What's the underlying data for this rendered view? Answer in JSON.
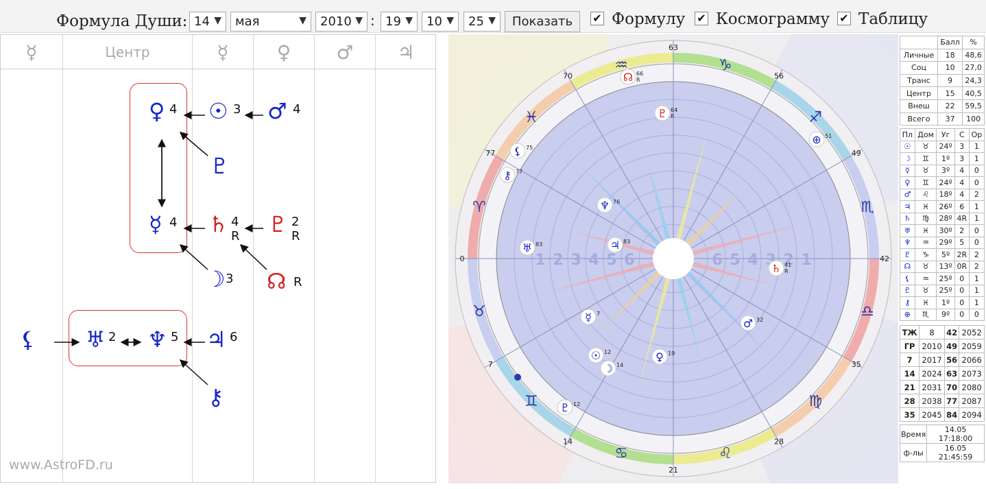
{
  "header": {
    "title": "Формула Души:",
    "day": "14",
    "month": "мая",
    "year": "2010",
    "separator": ":",
    "hour": "19",
    "minute": "10",
    "second": "25",
    "show_button": "Показать",
    "check_formula": "Формулу",
    "check_cosmogram": "Космограмму",
    "check_table": "Таблицу",
    "check_mark": "✔"
  },
  "formula": {
    "columns": [
      "☿",
      "Центр",
      "☿",
      "♀",
      "♂",
      "♃"
    ],
    "watermark": "www.AstroFD.ru",
    "glyphs": {
      "venus": "♀",
      "venus_n": "4",
      "sun": "☉",
      "sun_n": "3",
      "mars": "♂",
      "mars_n": "4",
      "proserpina": "♇",
      "mercury": "☿",
      "mercury_n": "4",
      "saturn": "♄",
      "saturn_n": "4",
      "saturn_r": "R",
      "pluto": "♇",
      "pluto_n": "2",
      "pluto_r": "R",
      "moon": "☽",
      "moon_n": "3",
      "node": "☊",
      "node_r": "R",
      "lilith": "⚸",
      "uranus": "♅",
      "uranus_n": "2",
      "neptune": "♆",
      "neptune_n": "5",
      "jupiter": "♃",
      "jupiter_n": "6",
      "chiron": "⚷"
    }
  },
  "chart": {
    "degrees": [
      "0",
      "7",
      "14",
      "21",
      "28",
      "35",
      "42",
      "49",
      "56",
      "63",
      "70",
      "77"
    ],
    "signs": [
      "♈",
      "♉",
      "♊",
      "♋",
      "♌",
      "♍",
      "♎",
      "♏",
      "♐",
      "♑",
      "♒",
      "♓"
    ],
    "house_numbers": [
      "1",
      "2",
      "3",
      "4",
      "5",
      "6",
      "6",
      "5",
      "4",
      "3",
      "2",
      "1"
    ],
    "planets": [
      {
        "glyph": "☊",
        "deg": "66",
        "r": "R"
      },
      {
        "glyph": "♇",
        "deg": "64",
        "r": "R"
      },
      {
        "glyph": "⚸",
        "deg": "75"
      },
      {
        "glyph": "⚷",
        "deg": "77"
      },
      {
        "glyph": "⊕",
        "deg": "51"
      },
      {
        "glyph": "♆",
        "deg": "76"
      },
      {
        "glyph": "♅",
        "deg": "83"
      },
      {
        "glyph": "♃",
        "deg": "83"
      },
      {
        "glyph": "♄",
        "deg": "41",
        "r": "R"
      },
      {
        "glyph": "☿",
        "deg": "7"
      },
      {
        "glyph": "♂",
        "deg": "32"
      },
      {
        "glyph": "☉",
        "deg": "12"
      },
      {
        "glyph": "☽",
        "deg": "14"
      },
      {
        "glyph": "♀",
        "deg": "19"
      },
      {
        "glyph": "♇",
        "deg": "12"
      }
    ]
  },
  "table_scores": {
    "head": [
      "",
      "Балл",
      "%"
    ],
    "rows": [
      [
        "Личные",
        "18",
        "48,6"
      ],
      [
        "Соц",
        "10",
        "27,0"
      ],
      [
        "Транс",
        "9",
        "24,3"
      ],
      [
        "Центр",
        "15",
        "40,5"
      ],
      [
        "Внеш",
        "22",
        "59,5"
      ],
      [
        "Всего",
        "37",
        "100"
      ]
    ]
  },
  "table_planets": {
    "head": [
      "Пл",
      "Дом",
      "Уг",
      "С",
      "Ор"
    ],
    "rows": [
      [
        "☉",
        "♉",
        "24º",
        "3",
        "1"
      ],
      [
        "☽",
        "♊",
        "1º",
        "3",
        "1"
      ],
      [
        "☿",
        "♉",
        "3º",
        "4",
        "0"
      ],
      [
        "♀",
        "♊",
        "24º",
        "4",
        "0"
      ],
      [
        "♂",
        "♌",
        "18º",
        "4",
        "2"
      ],
      [
        "♃",
        "♓",
        "26º",
        "6",
        "1"
      ],
      [
        "♄",
        "♍",
        "28º",
        "4R",
        "1"
      ],
      [
        "♅",
        "♓",
        "30º",
        "2",
        "0"
      ],
      [
        "♆",
        "♒",
        "29º",
        "5",
        "0"
      ],
      [
        "♇",
        "♑",
        "5º",
        "2R",
        "2"
      ],
      [
        "☊",
        "♉",
        "13º",
        "0R",
        "2"
      ],
      [
        "⚸",
        "♒",
        "25º",
        "0",
        "1"
      ],
      [
        "♇",
        "♉",
        "25º",
        "0",
        "1"
      ],
      [
        "⚷",
        "♓",
        "1º",
        "0",
        "1"
      ],
      [
        "⊕",
        "♏",
        "9º",
        "0",
        "0"
      ]
    ]
  },
  "table_years": {
    "rows": [
      [
        "ТЖ",
        "8",
        "42",
        "2052"
      ],
      [
        "ГР",
        "2010",
        "49",
        "2059"
      ],
      [
        "7",
        "2017",
        "56",
        "2066"
      ],
      [
        "14",
        "2024",
        "63",
        "2073"
      ],
      [
        "21",
        "2031",
        "70",
        "2080"
      ],
      [
        "28",
        "2038",
        "77",
        "2087"
      ],
      [
        "35",
        "2045",
        "84",
        "2094"
      ]
    ]
  },
  "table_time": {
    "rows": [
      [
        "Время",
        "14.05 17:18:00"
      ],
      [
        "ф-лы",
        "16.05 21:45:59"
      ]
    ]
  },
  "colors": {
    "planet_blue": "#1526c8",
    "planet_red": "#d81d1d",
    "box_border": "#dd3333"
  }
}
